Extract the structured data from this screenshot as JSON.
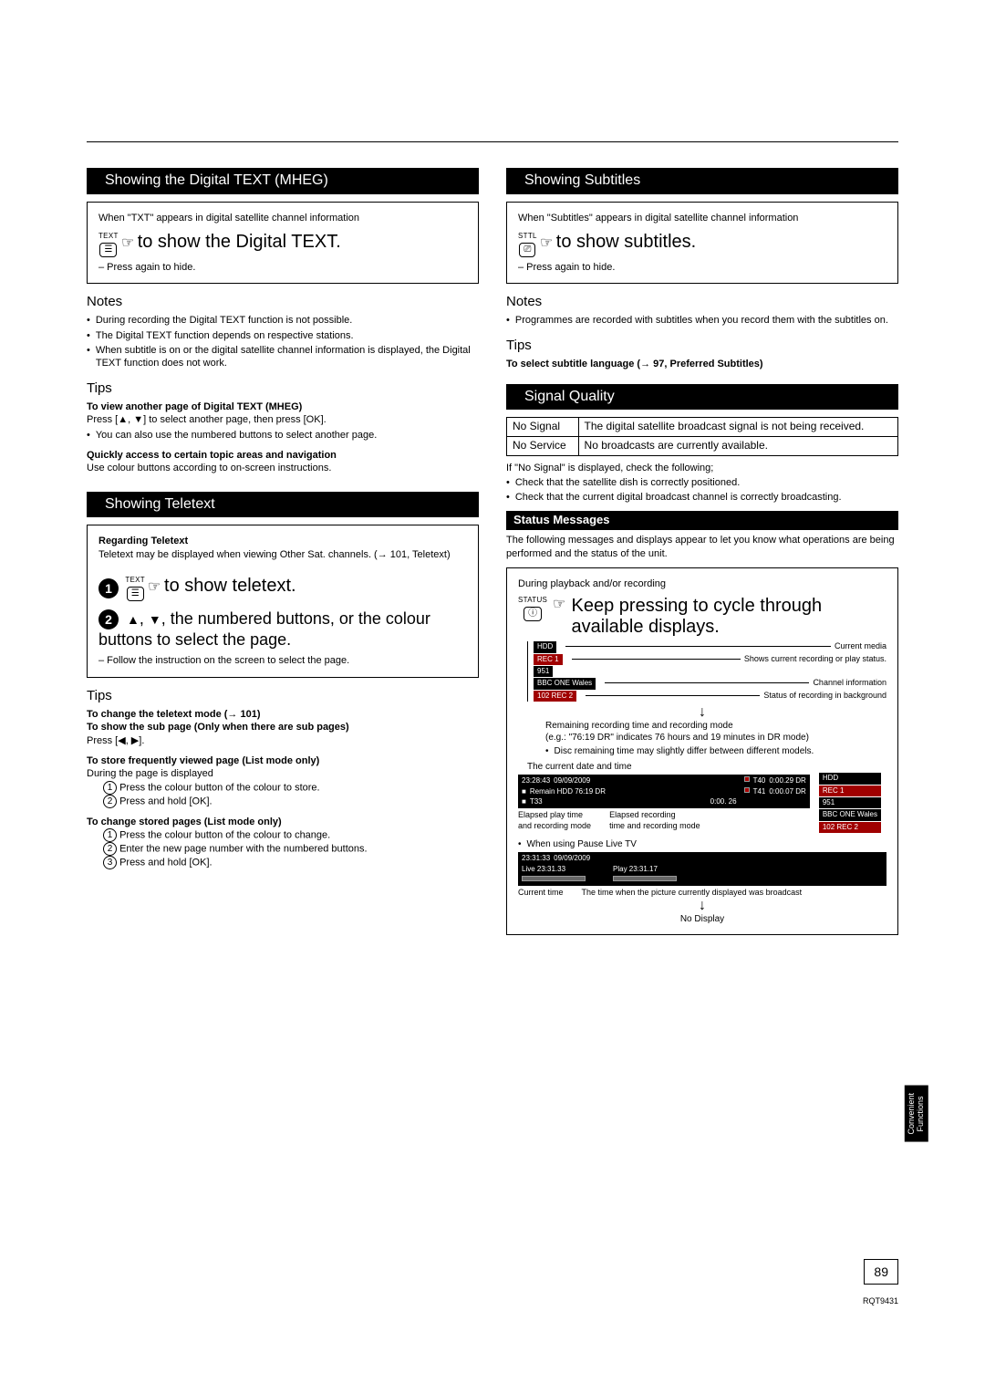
{
  "left": {
    "sec1": {
      "title": "Showing the Digital TEXT (MHEG)",
      "intro": "When \"TXT\" appears in digital satellite channel information",
      "btn_label": "TEXT",
      "action": "to show the Digital TEXT.",
      "hide": "– Press again to hide.",
      "notes_head": "Notes",
      "notes": [
        "During recording the Digital TEXT function is not possible.",
        "The Digital TEXT function depends on respective stations.",
        "When subtitle is on or the digital satellite channel information is displayed, the Digital TEXT function does not work."
      ],
      "tips_head": "Tips",
      "tip_a_head": "To view another page of Digital TEXT (MHEG)",
      "tip_a_body_1": "Press [",
      "tip_a_body_2": "] to select another page, then press [OK].",
      "tip_a_bullet": "You can also use the numbered buttons to select another page.",
      "tip_b_head": "Quickly access to certain topic areas and navigation",
      "tip_b_body": "Use colour buttons according to on-screen instructions."
    },
    "sec2": {
      "title": "Showing Teletext",
      "regarding": "Regarding Teletext",
      "regarding_body_1": "Teletext may be displayed when viewing Other Sat. channels. (",
      "regarding_body_ref": "→ 101, Teletext)",
      "btn_label": "TEXT",
      "step1": "to show teletext.",
      "step2_a": ", the numbered buttons, or the colour buttons to select the page.",
      "follow": "– Follow the instruction on the screen to select the page.",
      "tips_head": "Tips",
      "t1": "To change the teletext mode (→ 101)",
      "t2": "To show the sub page (Only when there are sub pages)",
      "t2b_1": "Press [",
      "t2b_2": "].",
      "t3": "To store frequently viewed page (List mode only)",
      "t3a": "During the page is displayed",
      "t3_1": "Press the colour button of the colour to store.",
      "t3_2": "Press and hold [OK].",
      "t4": "To change stored pages (List mode only)",
      "t4_1": "Press the colour button of the colour to change.",
      "t4_2": "Enter the new page number with the numbered buttons.",
      "t4_3": "Press and hold [OK]."
    }
  },
  "right": {
    "sec1": {
      "title": "Showing Subtitles",
      "intro": "When \"Subtitles\" appears in digital satellite channel information",
      "btn_label": "STTL",
      "action": "to show subtitles.",
      "hide": "– Press again to hide.",
      "notes_head": "Notes",
      "notes": [
        "Programmes are recorded with subtitles when you record them with the subtitles on."
      ],
      "tips_head": "Tips",
      "tip_head": "To select subtitle language (→ 97, Preferred Subtitles)"
    },
    "sigq": {
      "title": "Signal Quality",
      "rows": [
        {
          "k": "No Signal",
          "v": "The digital satellite broadcast signal is not being received."
        },
        {
          "k": "No Service",
          "v": "No broadcasts are currently available."
        }
      ],
      "after_1": "If \"No Signal\" is displayed, check the following;",
      "after_b": [
        "Check that the satellite dish is correctly positioned.",
        "Check that the current digital broadcast channel is correctly broadcasting."
      ]
    },
    "status": {
      "title": "Status Messages",
      "intro": "The following messages and displays appear to let you know what operations are being performed and the status of the unit.",
      "during": "During playback and/or recording",
      "btn_label": "STATUS",
      "action": "Keep pressing to cycle through available displays.",
      "osd1": {
        "chips": [
          "HDD",
          "REC 1",
          "951",
          "BBC ONE Wales",
          "102 REC 2"
        ],
        "labels": [
          "Current media",
          "Shows current recording or play status.",
          "Channel information",
          "Status of recording in background"
        ],
        "remain_note": "Remaining recording time and recording mode\n(e.g.: \"76:19 DR\" indicates 76 hours and 19 minutes in DR mode)",
        "disc_note": "Disc remaining time may slightly differ between different models.",
        "date_note": "The current date and time"
      },
      "osd2": {
        "time": "23:28:43",
        "date": "09/09/2009",
        "remain": "Remain HDD 76:19 DR",
        "t33": "T33",
        "t33t": "0:00. 26",
        "rec1": "T40",
        "rec1t": "0:00.29  DR",
        "rec2": "T41",
        "rec2t": "0:00.07  DR",
        "side": [
          "HDD",
          "REC 1",
          "951",
          "BBC ONE Wales",
          "102 REC 2"
        ]
      },
      "caption_row": {
        "a": "Elapsed play time\nand recording mode",
        "b": "Elapsed recording\ntime and recording mode"
      },
      "pause_note": "When using Pause Live TV",
      "osd3": {
        "time": "23:31:33",
        "date": "09/09/2009",
        "live": "Live 23:31.33",
        "play": "Play  23:31.17"
      },
      "caption_row2": {
        "a": "Current time",
        "b": "The time when the picture currently displayed was broadcast"
      },
      "no_display": "No Display"
    }
  },
  "page_num": "89",
  "doc_id": "RQT9431",
  "side_tab": "Convenient\nFunctions"
}
